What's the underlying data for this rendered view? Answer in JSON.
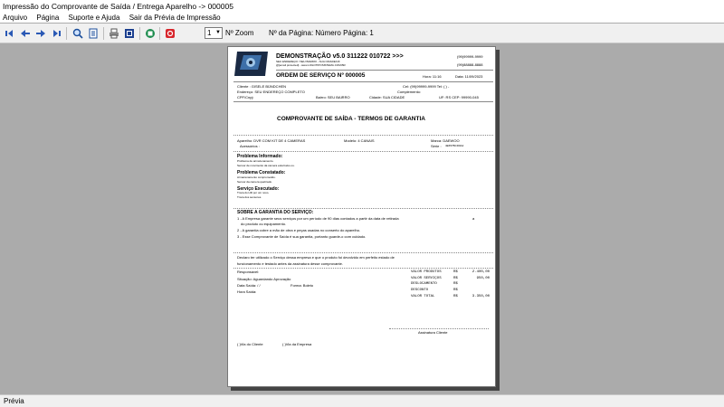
{
  "window": {
    "title": "Impressão do Comprovante de Saída / Entrega Aparelho -> 000005"
  },
  "menu": {
    "items": [
      "Arquivo",
      "Página",
      "Suporte e Ajuda",
      "Sair da Prévia de Impressão"
    ]
  },
  "toolbar": {
    "buttons": [
      "first-page-icon",
      "prev-page-icon",
      "next-page-icon",
      "last-page-icon",
      "zoom-icon",
      "page-setup-icon",
      "print-icon",
      "options-icon",
      "export-icon",
      "close-icon"
    ],
    "zoom_value": "1",
    "zoom_label": "Nº Zoom",
    "page_label": "Nº da Página: Número Página: 1"
  },
  "status": {
    "text": "Prévia"
  },
  "doc": {
    "company": "DEMONSTRAÇÃO v5.0 311222 010722 >>>",
    "company_addr": "SEU ENDEREÇO / SEU BAIRRO - SUA CIDADE/UF",
    "company_contact": "@[email protected]  -  www.LOGOTIPOSISTEMA.COM.BR",
    "phone1": "(99)99999-9999",
    "phone2": "(99)88888-8888",
    "os_title": "ORDEM DE SERVIÇO Nº 000005",
    "hora": "Hora: 11:16",
    "data": "Data: 11/09/2023",
    "cliente": "Cliente : GISELE BÜNDCHEN",
    "cel": "Cel: (99)99999-9999  Tel: (   )      -",
    "endereco": "Endereço: SEU ENDEREÇO COMPLETO",
    "complemento": "Complemento:",
    "cpf": "CPF/Cnpj:",
    "bairro": "Bairro: SEU BAIRRO",
    "cidade": "Cidade: SUA CIDADE",
    "uf_cep": "UF: RS  CEP: 99990-045",
    "heading": "COMPROVANTE DE SAÍDA - TERMOS DE GARANTIA",
    "aparelho": "Aparelho: DVR COM KIT DE 4 CAMERAS",
    "modelo": "Modelo: 4 CANAIS",
    "marca": "Marca: DAEWOO",
    "acessorios": "Acessórios :",
    "serie": "Série :",
    "serie_val": "4E657BCD9A2",
    "prob_inf_title": "Problema Informado:",
    "prob_inf_l1": "Problema de armazenamento.",
    "prob_inf_l2": "Sensor de movimento da camera esta baixo ou.",
    "prob_const_title": "Problema Constatado:",
    "prob_const_l1": "Armazenamento comprometido.",
    "prob_const_l2": "Sensor da camera quebrado.",
    "serv_title": "Serviço Executado:",
    "serv_l1": "Troca do HD por um novo.",
    "serv_l2": "Troca dos sensores.",
    "garantia_title": "SOBRE A GARANTIA DO SERVIÇO:",
    "gar1a": "1 - A Empresa garante seus serviços por um período de 90 dias contados a partir da data de retirada",
    "gar1b": "do produto ou equipamento.",
    "gar1c": "a",
    "gar2": "2 - A garantia cobre a mão de obra e peças usadas no conserto do aparelho.",
    "gar3": "3 - Esse Comprovante de Saída é sua garantia, portanto guarde-o com cuidado.",
    "declaro1": "Declaro ter utilizado o Serviço dessa empresa e que o produto foi devolvido em perfeito estado de",
    "declaro2": "funcionamento e testado antes da assinatura desse comprovante.",
    "responsavel": "Responsável:",
    "situacao": "Situação: Aguardando Aprovação",
    "data_saida": "Data Saída:   /   /",
    "forma": "Forma: Boleto",
    "hora_saida": "Hora Saída:",
    "totals": [
      {
        "label": "VALOR PRODUTOS",
        "cur": "R$",
        "value": "2.400,00"
      },
      {
        "label": "VALOR SERVIÇOS",
        "cur": "R$",
        "value": "950,00"
      },
      {
        "label": "DESLOCAMENTO",
        "cur": "R$",
        "value": ""
      },
      {
        "label": "DESCONTO",
        "cur": "R$",
        "value": ""
      },
      {
        "label": "VALOR TOTAL",
        "cur": "R$",
        "value": "3.350,00"
      }
    ],
    "assinatura": "Assinatura Cliente",
    "via_cliente": "(   )Via do Cliente",
    "via_empresa": "(   )Via da Empresa"
  }
}
